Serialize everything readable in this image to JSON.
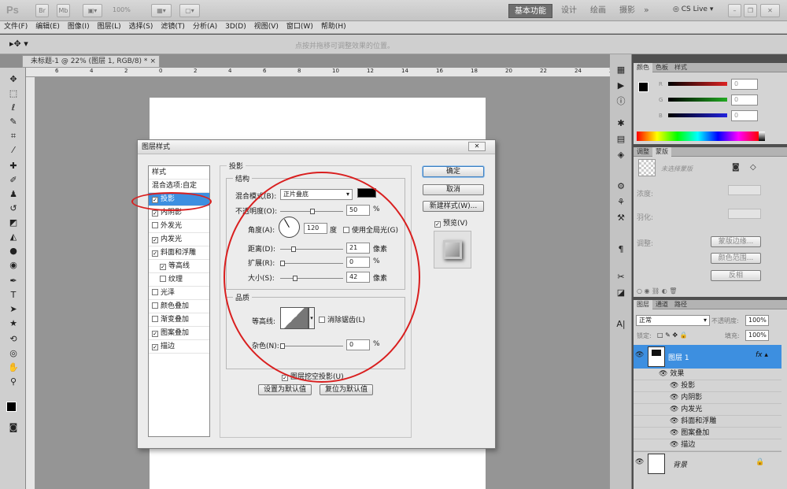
{
  "app": {
    "logo": "Ps",
    "zoom": "100%",
    "cslive": "CS Live"
  },
  "workspaces": [
    "基本功能",
    "设计",
    "绘画",
    "摄影"
  ],
  "menu": [
    "文件(F)",
    "编辑(E)",
    "图像(I)",
    "图层(L)",
    "选择(S)",
    "滤镜(T)",
    "分析(A)",
    "3D(D)",
    "视图(V)",
    "窗口(W)",
    "帮助(H)"
  ],
  "options": {
    "hint": "点按并拖移可调整效果的位置。"
  },
  "doc": {
    "tab": "未标题-1 @ 22% (图层 1, RGB/8) *"
  },
  "ruler": [
    "6",
    "4",
    "2",
    "0",
    "2",
    "4",
    "6",
    "8",
    "10",
    "12",
    "14",
    "16",
    "18",
    "20",
    "22",
    "24",
    "26"
  ],
  "dialog": {
    "title": "图层样式",
    "styles_header": "样式",
    "blend_options": "混合选项:自定",
    "styles": [
      {
        "label": "投影",
        "checked": true,
        "selected": true
      },
      {
        "label": "内阴影",
        "checked": true
      },
      {
        "label": "外发光",
        "checked": false
      },
      {
        "label": "内发光",
        "checked": true
      },
      {
        "label": "斜面和浮雕",
        "checked": true
      },
      {
        "label": "等高线",
        "checked": true,
        "indent": true
      },
      {
        "label": "纹理",
        "checked": false,
        "indent": true
      },
      {
        "label": "光泽",
        "checked": false
      },
      {
        "label": "颜色叠加",
        "checked": false
      },
      {
        "label": "渐变叠加",
        "checked": false
      },
      {
        "label": "图案叠加",
        "checked": true
      },
      {
        "label": "描边",
        "checked": true
      }
    ],
    "section_title": "投影",
    "structure_label": "结构",
    "blend_mode_label": "混合模式(B):",
    "blend_mode_value": "正片叠底",
    "opacity_label": "不透明度(O):",
    "opacity_value": "50",
    "angle_label": "角度(A):",
    "angle_value": "120",
    "angle_unit": "度",
    "global_light": "使用全局光(G)",
    "distance_label": "距离(D):",
    "distance_value": "21",
    "spread_label": "扩展(R):",
    "spread_value": "0",
    "size_label": "大小(S):",
    "size_value": "42",
    "px_unit": "像素",
    "pct_unit": "%",
    "quality_label": "品质",
    "contour_label": "等高线:",
    "antialias": "消除锯齿(L)",
    "noise_label": "杂色(N):",
    "noise_value": "0",
    "knockout": "图层挖空投影(U)",
    "make_default": "设置为默认值",
    "reset_default": "复位为默认值",
    "ok": "确定",
    "cancel": "取消",
    "new_style": "新建样式(W)...",
    "preview": "预览(V)"
  },
  "color_panel": {
    "tabs": [
      "颜色",
      "色板",
      "样式"
    ],
    "channels": [
      {
        "label": "R",
        "value": "0",
        "color": "#d22"
      },
      {
        "label": "G",
        "value": "0",
        "color": "#2a2"
      },
      {
        "label": "B",
        "value": "0",
        "color": "#22d"
      }
    ]
  },
  "adjust_panel": {
    "tabs": [
      "调整",
      "蒙版"
    ],
    "no_mask": "未选择蒙版",
    "density": "浓度:",
    "feather": "羽化:",
    "refine": "调整:",
    "mask_edge": "蒙版边缘...",
    "color_range": "颜色范围...",
    "invert": "反相"
  },
  "layers_panel": {
    "tabs": [
      "图层",
      "通道",
      "路径"
    ],
    "mode": "正常",
    "opacity_label": "不透明度:",
    "opacity": "100%",
    "lock_label": "锁定:",
    "fill_label": "填充:",
    "fill": "100%",
    "layer1": "图层 1",
    "effects_label": "效果",
    "effects": [
      "投影",
      "内阴影",
      "内发光",
      "斜面和浮雕",
      "图案叠加",
      "描边"
    ],
    "background": "背景"
  }
}
